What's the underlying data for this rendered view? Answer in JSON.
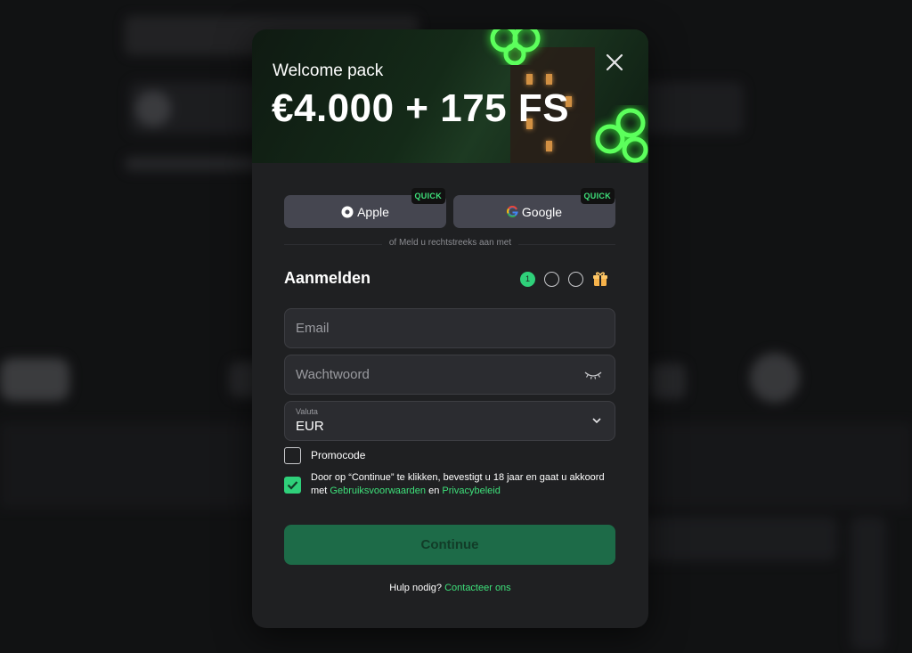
{
  "banner": {
    "subtitle": "Welcome pack",
    "title": "€4.000 + 175 FS"
  },
  "social": {
    "apple_label": "Apple",
    "google_label": "Google",
    "quick_badge": "QUICK"
  },
  "divider_text": "of Meld u rechtstreeks aan met",
  "form": {
    "heading": "Aanmelden",
    "steps": [
      "1",
      "",
      ""
    ],
    "email_placeholder": "Email",
    "password_placeholder": "Wachtwoord",
    "currency_label": "Valuta",
    "currency_value": "EUR",
    "promocode_label": "Promocode",
    "promocode_checked": false,
    "terms_checked": true,
    "terms_prefix": "Door op “Continue” te klikken, bevestigt u 18 jaar en gaat u akkoord met ",
    "terms_link1": "Gebruiksvoorwaarden",
    "terms_and": " en ",
    "terms_link2": "Privacybeleid",
    "continue_label": "Continue",
    "help_text": "Hulp nodig? ",
    "help_link": "Contacteer ons"
  },
  "colors": {
    "accent": "#2fd07a",
    "button": "#1d6b48",
    "modal_bg": "#1f2022"
  },
  "icons": [
    "close-icon",
    "apple-icon",
    "google-icon",
    "eye-closed-icon",
    "chevron-down-icon",
    "gift-icon",
    "check-icon",
    "clover-icon"
  ]
}
